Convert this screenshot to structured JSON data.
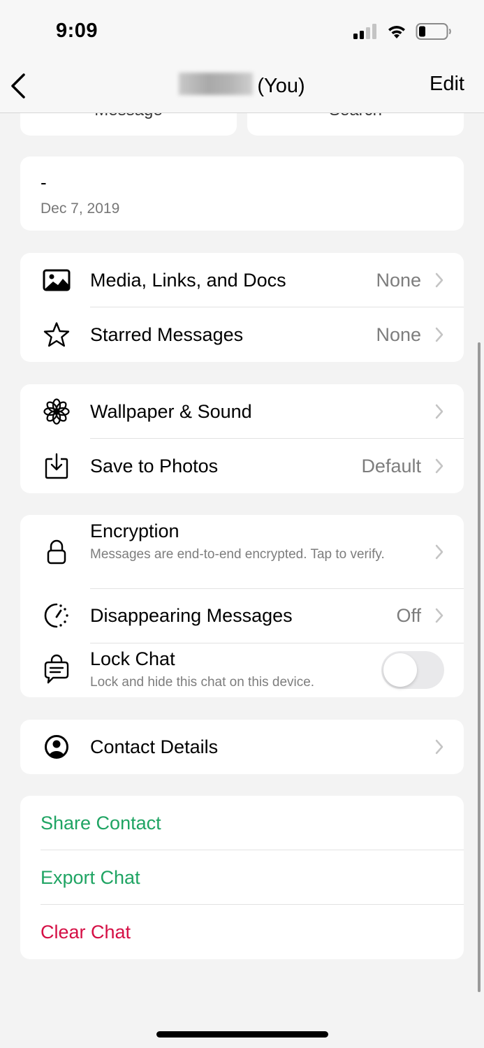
{
  "status_bar": {
    "time": "9:09",
    "icons": [
      "cellular-signal-icon",
      "wifi-icon",
      "battery-icon"
    ]
  },
  "nav": {
    "back_icon": "chevron-left-icon",
    "title_suffix": "(You)",
    "edit_label": "Edit"
  },
  "top_buttons": {
    "message_label": "Message",
    "search_label": "Search"
  },
  "about": {
    "text": "-",
    "date": "Dec 7, 2019"
  },
  "group1": [
    {
      "icon": "photo-icon",
      "label": "Media, Links, and Docs",
      "value": "None"
    },
    {
      "icon": "star-icon",
      "label": "Starred Messages",
      "value": "None"
    }
  ],
  "group2": [
    {
      "icon": "flower-icon",
      "label": "Wallpaper & Sound",
      "value": ""
    },
    {
      "icon": "save-download-icon",
      "label": "Save to Photos",
      "value": "Default"
    }
  ],
  "group3": {
    "encryption": {
      "icon": "lock-icon",
      "label": "Encryption",
      "sub": "Messages are end-to-end encrypted. Tap to verify."
    },
    "disappearing": {
      "icon": "timer-icon",
      "label": "Disappearing Messages",
      "value": "Off"
    },
    "lock_chat": {
      "icon": "chat-lock-icon",
      "label": "Lock Chat",
      "sub": "Lock and hide this chat on this device.",
      "enabled": false
    }
  },
  "group4": {
    "contact_details": {
      "icon": "person-circle-icon",
      "label": "Contact Details"
    }
  },
  "actions": [
    {
      "label": "Share Contact",
      "color": "#1fa463"
    },
    {
      "label": "Export Chat",
      "color": "#1fa463"
    },
    {
      "label": "Clear Chat",
      "color": "#d50f45"
    }
  ]
}
